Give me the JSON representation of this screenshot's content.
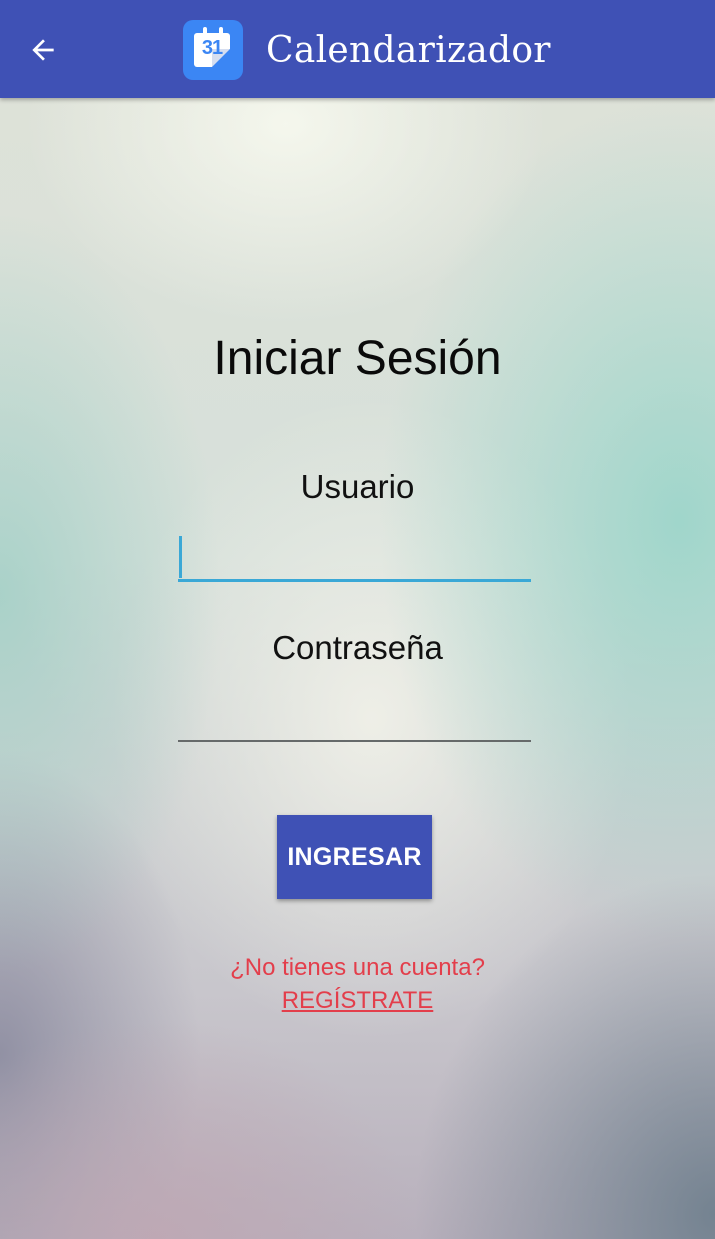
{
  "app_bar": {
    "title": "Calendarizador",
    "logo_day": "31",
    "back_icon": "arrow-left-icon",
    "logo_icon": "calendar-icon",
    "background_color": "#3f51b5"
  },
  "login": {
    "heading": "Iniciar Sesión",
    "username": {
      "label": "Usuario",
      "value": "",
      "focused": true
    },
    "password": {
      "label": "Contraseña",
      "value": ""
    },
    "submit_label": "INGRESAR",
    "signup_prompt": "¿No tienes una cuenta?",
    "signup_link": "REGÍSTRATE"
  },
  "colors": {
    "primary": "#3f51b5",
    "focus_underline": "#3aa8d6",
    "link_red": "#e33e4b"
  }
}
